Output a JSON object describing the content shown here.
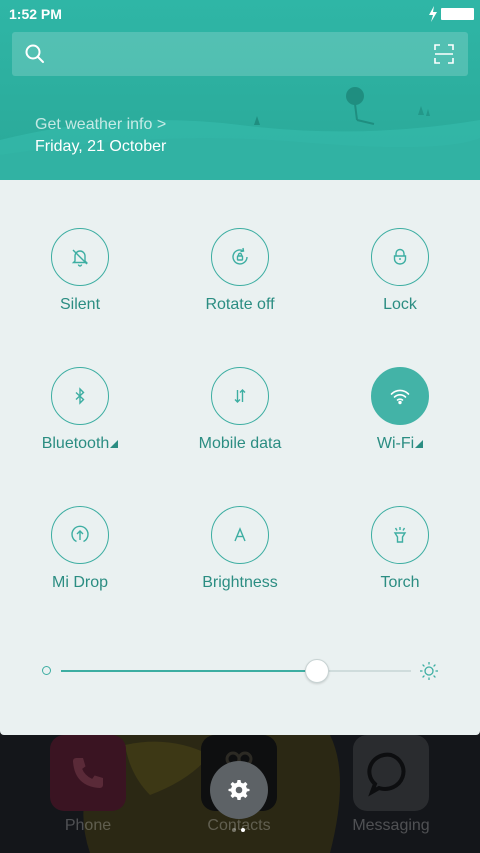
{
  "status": {
    "time": "1:52 PM"
  },
  "header": {
    "weather_link": "Get weather info >",
    "date": "Friday, 21 October"
  },
  "tiles": [
    {
      "label": "Silent",
      "icon": "bell-off-icon",
      "active": false,
      "expandable": false
    },
    {
      "label": "Rotate off",
      "icon": "rotate-lock-icon",
      "active": false,
      "expandable": false
    },
    {
      "label": "Lock",
      "icon": "lock-icon",
      "active": false,
      "expandable": false
    },
    {
      "label": "Bluetooth",
      "icon": "bluetooth-icon",
      "active": false,
      "expandable": true
    },
    {
      "label": "Mobile data",
      "icon": "mobile-data-icon",
      "active": false,
      "expandable": false
    },
    {
      "label": "Wi-Fi",
      "icon": "wifi-icon",
      "active": true,
      "expandable": true
    },
    {
      "label": "Mi Drop",
      "icon": "mi-drop-icon",
      "active": false,
      "expandable": false
    },
    {
      "label": "Brightness",
      "icon": "brightness-auto-icon",
      "active": false,
      "expandable": false
    },
    {
      "label": "Torch",
      "icon": "torch-icon",
      "active": false,
      "expandable": false
    }
  ],
  "brightness": {
    "level": 0.73
  },
  "home": {
    "apps": [
      {
        "label": "Phone",
        "icon": "phone-icon"
      },
      {
        "label": "Contacts",
        "icon": "contacts-icon"
      },
      {
        "label": "Messaging",
        "icon": "messaging-icon"
      }
    ]
  },
  "colors": {
    "accent": "#3daea2",
    "header": "#2fb6a6",
    "panel": "#eaf1f1",
    "tile_label": "#2b8d82"
  }
}
